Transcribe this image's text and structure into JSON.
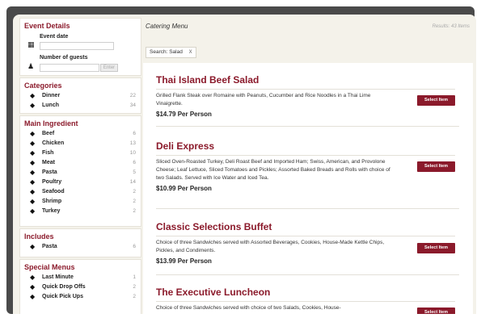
{
  "event_details": {
    "title": "Event Details",
    "event_date_label": "Event date",
    "event_date_value": "",
    "guests_label": "Number of guests",
    "guests_value": "",
    "enter_label": "Enter"
  },
  "categories": {
    "title": "Categories",
    "items": [
      {
        "label": "Dinner",
        "count": "22"
      },
      {
        "label": "Lunch",
        "count": "34"
      }
    ]
  },
  "main_ingredient": {
    "title": "Main Ingredient",
    "items": [
      {
        "label": "Beef",
        "count": "6"
      },
      {
        "label": "Chicken",
        "count": "13"
      },
      {
        "label": "Fish",
        "count": "10"
      },
      {
        "label": "Meat",
        "count": "6"
      },
      {
        "label": "Pasta",
        "count": "5"
      },
      {
        "label": "Poultry",
        "count": "14"
      },
      {
        "label": "Seafood",
        "count": "2"
      },
      {
        "label": "Shrimp",
        "count": "2"
      },
      {
        "label": "Turkey",
        "count": "2"
      }
    ]
  },
  "includes": {
    "title": "Includes",
    "items": [
      {
        "label": "Pasta",
        "count": "6"
      }
    ]
  },
  "special_menus": {
    "title": "Special Menus",
    "items": [
      {
        "label": "Last Minute",
        "count": "1"
      },
      {
        "label": "Quick Drop Offs",
        "count": "2"
      },
      {
        "label": "Quick Pick Ups",
        "count": "2"
      }
    ]
  },
  "header": {
    "title": "Catering Menu",
    "results": "Results: 43 Items"
  },
  "search_chip": {
    "label": "Search: Salad",
    "remove": "X"
  },
  "menu_items": [
    {
      "title": "Thai Island Beef Salad",
      "description": "Grilled Flank Steak over Romaine with Peanuts, Cucumber and Rice Noodles in a Thai Lime Vinaigrette.",
      "price": "$14.79 Per Person",
      "button": "Select Item"
    },
    {
      "title": "Deli Express",
      "description": "Sliced Oven-Roasted Turkey, Deli Roast Beef and Imported Ham; Swiss, American, and Provolone Cheese; Leaf Lettuce, Sliced Tomatoes and Pickles; Assorted Baked Breads and Rolls with choice of two Salads. Served with Ice Water and Iced Tea.",
      "price": "$10.99 Per Person",
      "button": "Select Item"
    },
    {
      "title": "Classic Selections Buffet",
      "description": "Choice of three Sandwiches served with Assorted Beverages, Cookies, House-Made Kettle Chips, Pickles, and Condiments.",
      "price": "$13.99 Per Person",
      "button": "Select Item"
    },
    {
      "title": "The Executive Luncheon",
      "description": "Choice of three Sandwiches served with choice of two Salads, Cookies, House-",
      "price": "",
      "button": "Select Item"
    }
  ],
  "colors": {
    "accent": "#8b1a2b",
    "frame": "#4a4a4a",
    "background": "#f4f2ea"
  }
}
